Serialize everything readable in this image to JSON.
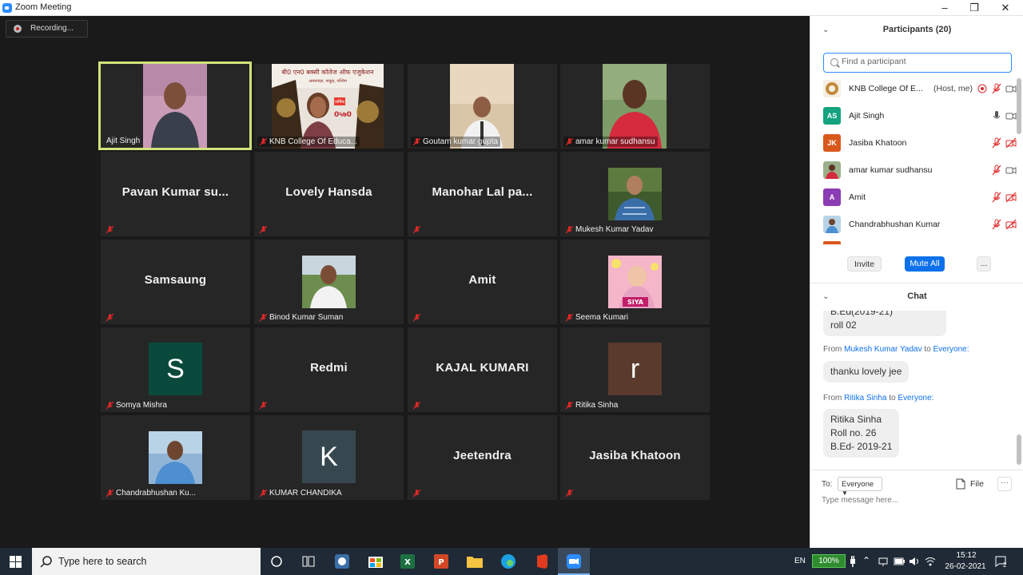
{
  "window": {
    "title": "Zoom Meeting"
  },
  "recording": {
    "label": "Recording..."
  },
  "tiles": [
    {
      "name": "Ajit Singh"
    },
    {
      "name": "KNB College Of Educa..."
    },
    {
      "name": "Goutam kumar gupta"
    },
    {
      "name": "amar kumar sudhansu"
    },
    {
      "display": "Pavan Kumar su..."
    },
    {
      "display": "Lovely Hansda"
    },
    {
      "display": "Manohar Lal pa..."
    },
    {
      "name": "Mukesh Kumar Yadav"
    },
    {
      "display": "Samsaung"
    },
    {
      "name": "Binod Kumar Suman"
    },
    {
      "display": "Amit"
    },
    {
      "name": "Seema Kumari"
    },
    {
      "name": "Somya Mishra",
      "initial": "S"
    },
    {
      "display": "Redmi"
    },
    {
      "display": "KAJAL KUMARI"
    },
    {
      "name": "Ritika Sinha",
      "initial": "r"
    },
    {
      "name": "Chandrabhushan Ku..."
    },
    {
      "name": "KUMAR CHANDIKA",
      "initial": "K"
    },
    {
      "display": "Jeetendra"
    },
    {
      "display": "Jasiba Khatoon"
    }
  ],
  "poster_text": {
    "line1": "बी0 एन0 बक्सी कॉलेज ऑफ एजुकेशन",
    "line2": "अमरापाड़ा, पाकुड़, पश्चिम",
    "stamp": "वार्षिक",
    "number": "0५७0"
  },
  "thumb_text": {
    "seema": "SIYA"
  },
  "participants": {
    "title": "Participants (20)",
    "search_placeholder": "Find a participant",
    "list": [
      {
        "name": "KNB College Of E...",
        "role": "(Host, me)",
        "avatar_color": "#b07a3c"
      },
      {
        "name": "Ajit Singh",
        "initials": "AS",
        "avatar_color": "#14a37f"
      },
      {
        "name": "Jasiba Khatoon",
        "initials": "JK",
        "avatar_color": "#d9581b"
      },
      {
        "name": "amar kumar sudhansu",
        "avatar_color": "#6a6a6a"
      },
      {
        "name": "Amit",
        "initials": "A",
        "avatar_color": "#8a3db3"
      },
      {
        "name": "Chandrabhushan Kumar",
        "avatar_color": "#4a6a8a"
      }
    ],
    "invite_label": "Invite",
    "mute_all_label": "Mute All",
    "more_label": "..."
  },
  "chat": {
    "title": "Chat",
    "messages": [
      {
        "text_lines": [
          "B.Ed(2019-21)",
          "roll 02"
        ]
      },
      {
        "from_prefix": "From",
        "from": "Mukesh Kumar Yadav",
        "to_prefix": "to",
        "to": "Everyone:",
        "text_lines": [
          "thanku lovely jee"
        ]
      },
      {
        "from_prefix": "From",
        "from": "Ritika Sinha",
        "to_prefix": "to",
        "to": "Everyone:",
        "text_lines": [
          "Ritika Sinha",
          "Roll no. 26",
          "B.Ed- 2019-21"
        ]
      }
    ],
    "to_label": "To:",
    "to_select": "Everyone",
    "file_label": "File",
    "more_label": "···",
    "input_placeholder": "Type message here..."
  },
  "taskbar": {
    "search_placeholder": "Type here to search",
    "lang": "EN",
    "battery": "100%",
    "time": "15:12",
    "date": "26-02-2021",
    "notifications": "2"
  },
  "colors": {
    "accent": "#0e71eb",
    "active_border": "#d3e27a",
    "mute_red": "#e02828"
  }
}
